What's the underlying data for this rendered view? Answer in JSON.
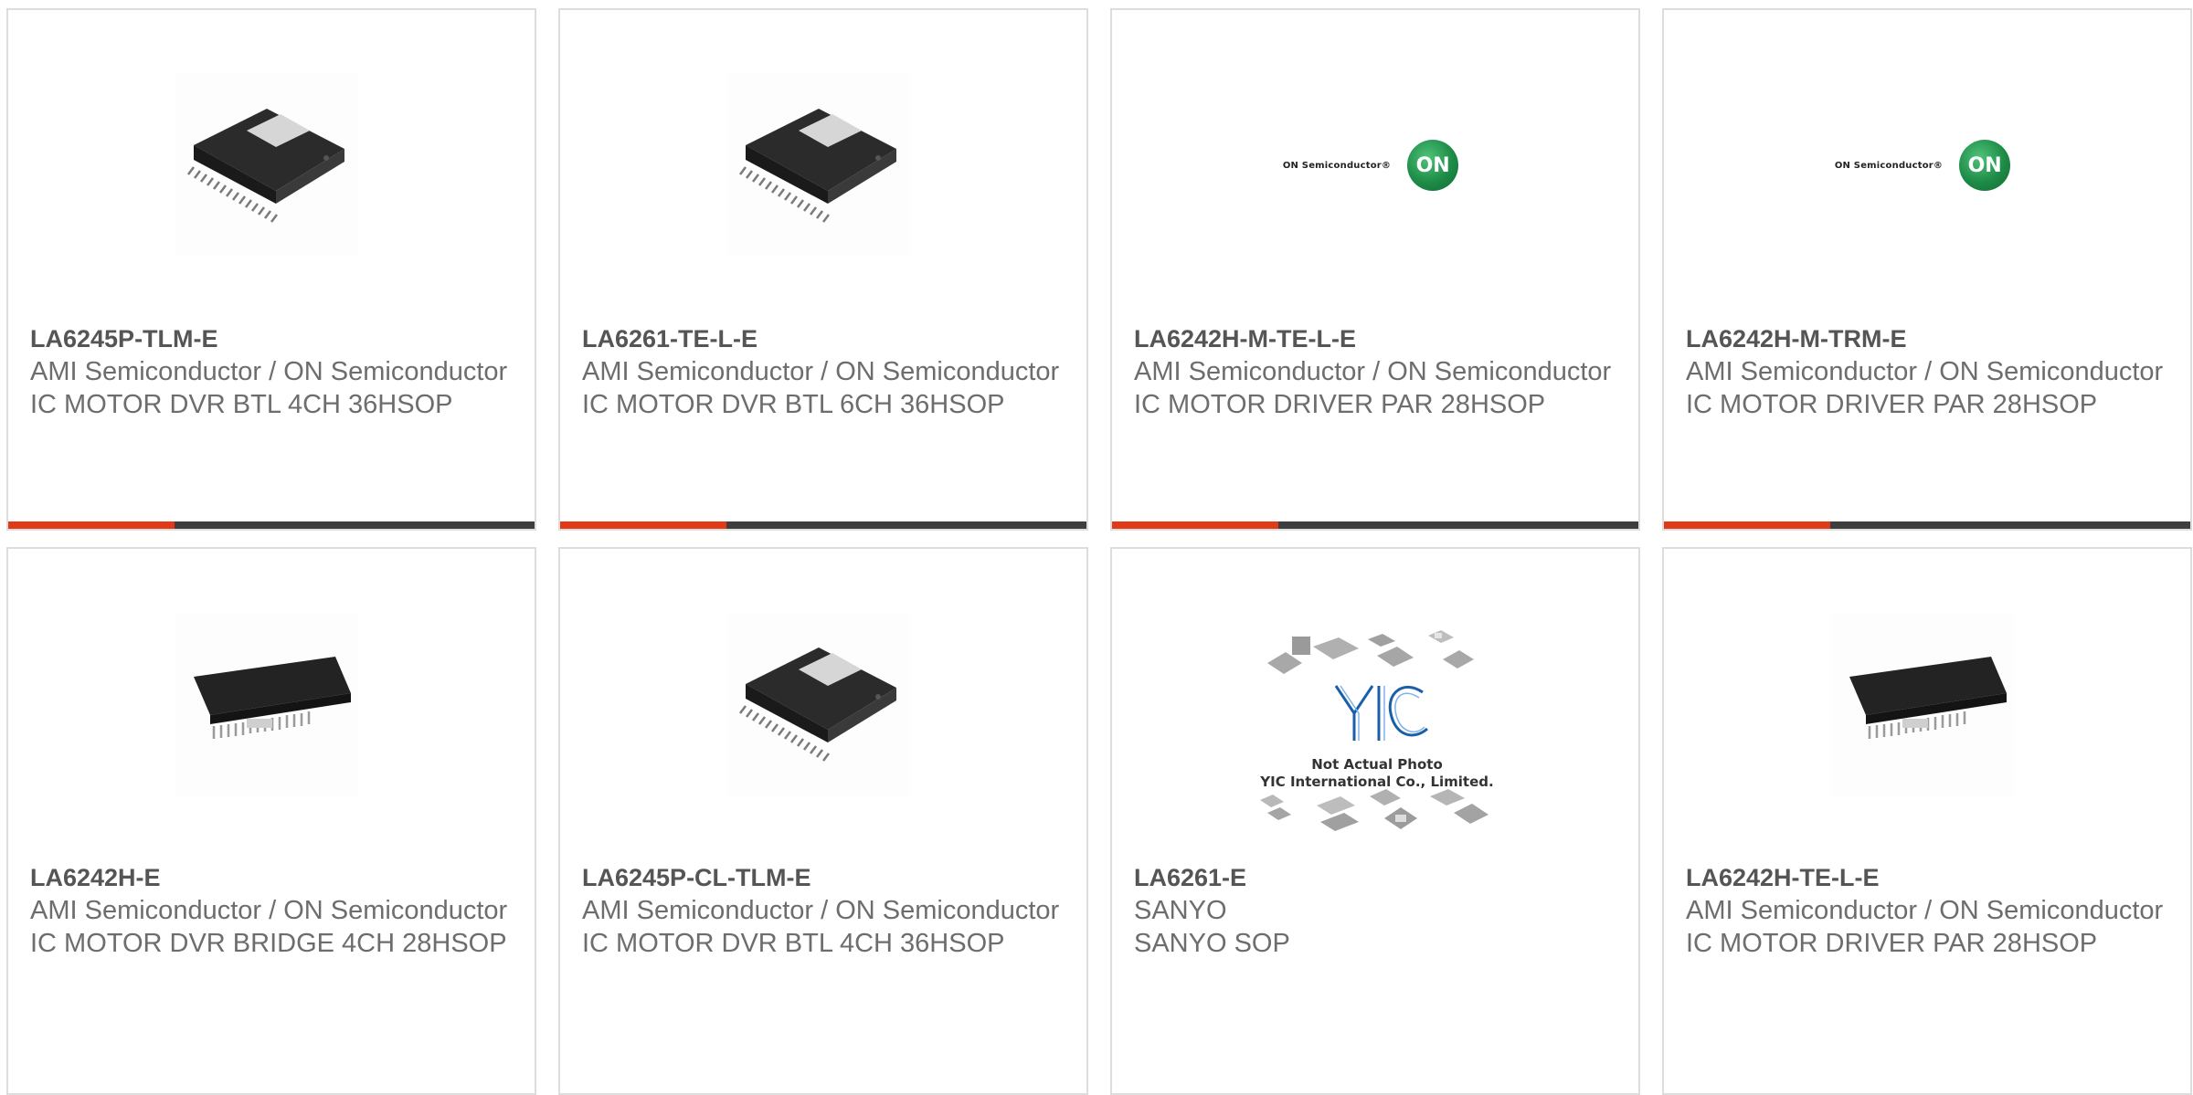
{
  "products": [
    {
      "part": "LA6245P-TLM-E",
      "manufacturer": "AMI Semiconductor / ON Semiconductor",
      "description": "IC MOTOR DVR BTL 4CH 36HSOP",
      "image": "hsop-chip-icon"
    },
    {
      "part": "LA6261-TE-L-E",
      "manufacturer": "AMI Semiconductor / ON Semiconductor",
      "description": "IC MOTOR DVR BTL 6CH 36HSOP",
      "image": "hsop-chip-icon"
    },
    {
      "part": "LA6242H-M-TE-L-E",
      "manufacturer": "AMI Semiconductor / ON Semiconductor",
      "description": "IC MOTOR DRIVER PAR 28HSOP",
      "image": "on-semi-logo"
    },
    {
      "part": "LA6242H-M-TRM-E",
      "manufacturer": "AMI Semiconductor / ON Semiconductor",
      "description": "IC MOTOR DRIVER PAR 28HSOP",
      "image": "on-semi-logo"
    },
    {
      "part": "LA6242H-E",
      "manufacturer": "AMI Semiconductor / ON Semiconductor",
      "description": "IC MOTOR DVR BRIDGE 4CH 28HSOP",
      "image": "hsop28-chip-icon"
    },
    {
      "part": "LA6245P-CL-TLM-E",
      "manufacturer": "AMI Semiconductor / ON Semiconductor",
      "description": "IC MOTOR DVR BTL 4CH 36HSOP",
      "image": "hsop-chip-icon"
    },
    {
      "part": "LA6261-E",
      "manufacturer": "SANYO",
      "description": "SANYO SOP",
      "image": "yic-placeholder"
    },
    {
      "part": "LA6242H-TE-L-E",
      "manufacturer": "AMI Semiconductor / ON Semiconductor",
      "description": "IC MOTOR DRIVER PAR 28HSOP",
      "image": "hsop28-chip-icon"
    }
  ],
  "logos": {
    "on_semi_text": "ON Semiconductor®",
    "on_disc_text": "ON",
    "yic_line1": "Not Actual Photo",
    "yic_line2": "YIC International Co., Limited."
  },
  "colors": {
    "accent": "#e23a17",
    "bar": "#3e3e3e",
    "border": "#dddddd",
    "text": "#6d6d6d"
  }
}
